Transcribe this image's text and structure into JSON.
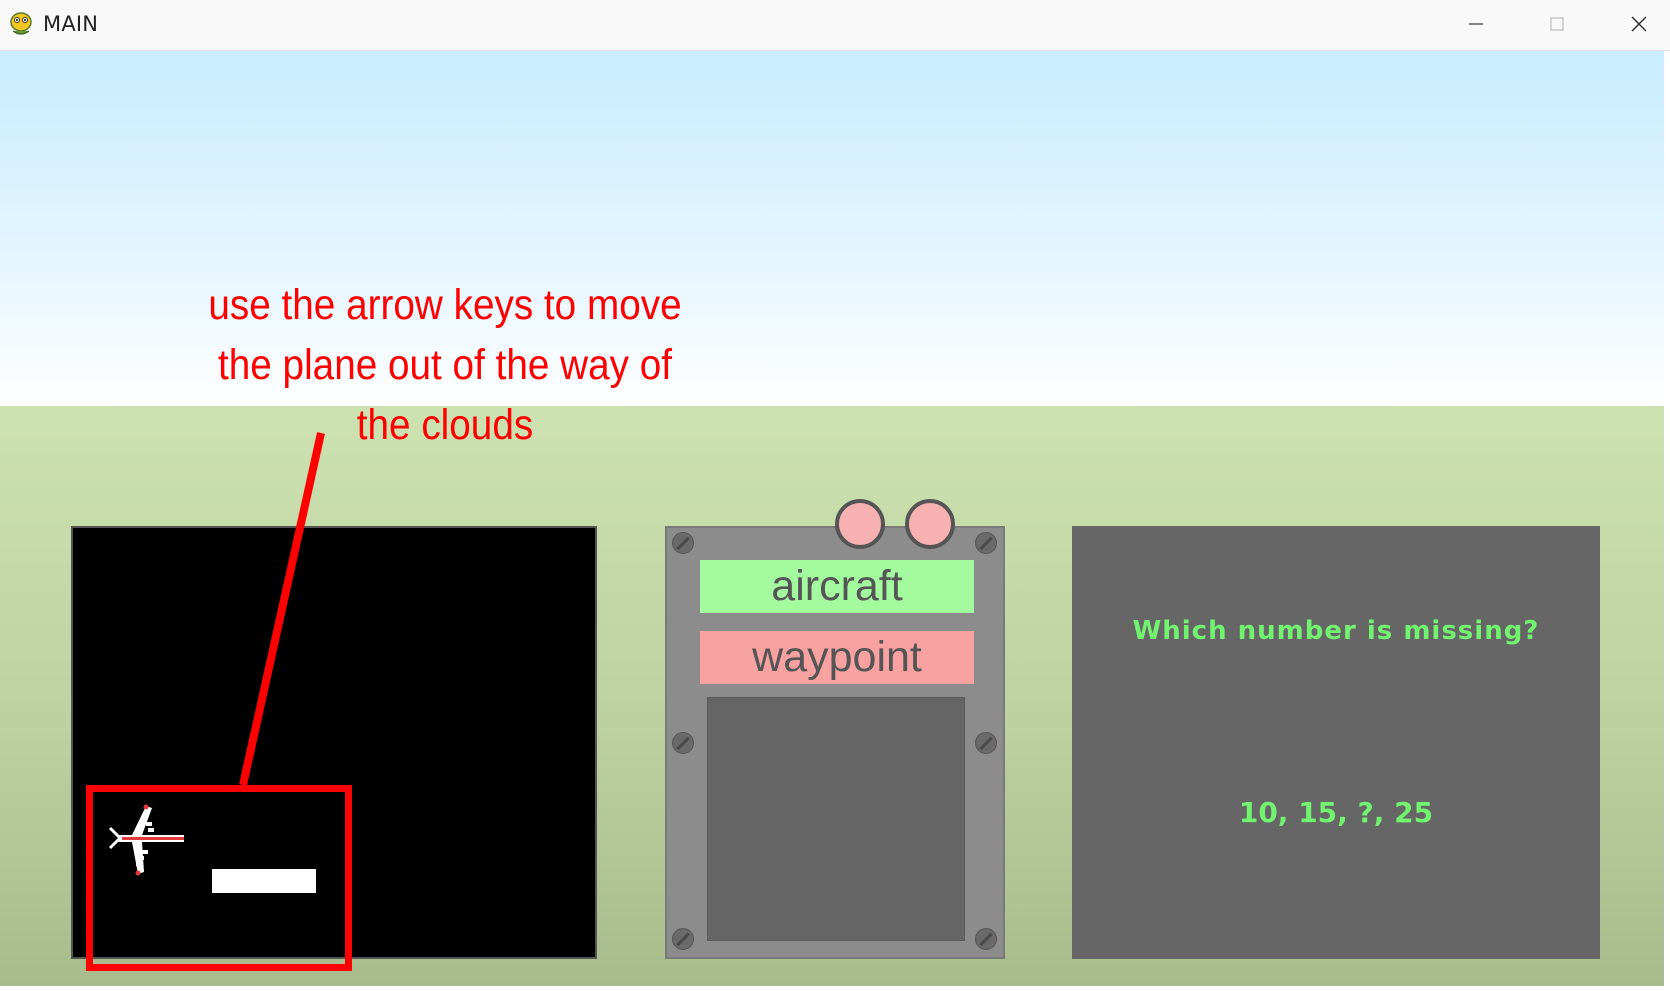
{
  "window": {
    "title": "MAIN",
    "icon": "pygame-snake-icon",
    "controls": [
      "minimize-icon",
      "maximize-icon",
      "close-icon"
    ]
  },
  "instruction": {
    "lines": [
      "use the arrow keys to move",
      "the plane out of the way of",
      "the clouds"
    ],
    "color": "#ff0000"
  },
  "radar": {
    "background": "#000000",
    "player_icon": "airplane-icon",
    "highlight_color": "#ff0000"
  },
  "control_panel": {
    "aircraft_label": "aircraft",
    "aircraft_color": "#a4fa9f",
    "waypoint_label": "waypoint",
    "waypoint_color": "#f8a1a1",
    "knob_color": "#f8b1b1"
  },
  "question_panel": {
    "question": "Which number is missing?",
    "sequence": "10, 15, ?, 25",
    "text_color": "#72f36f"
  }
}
